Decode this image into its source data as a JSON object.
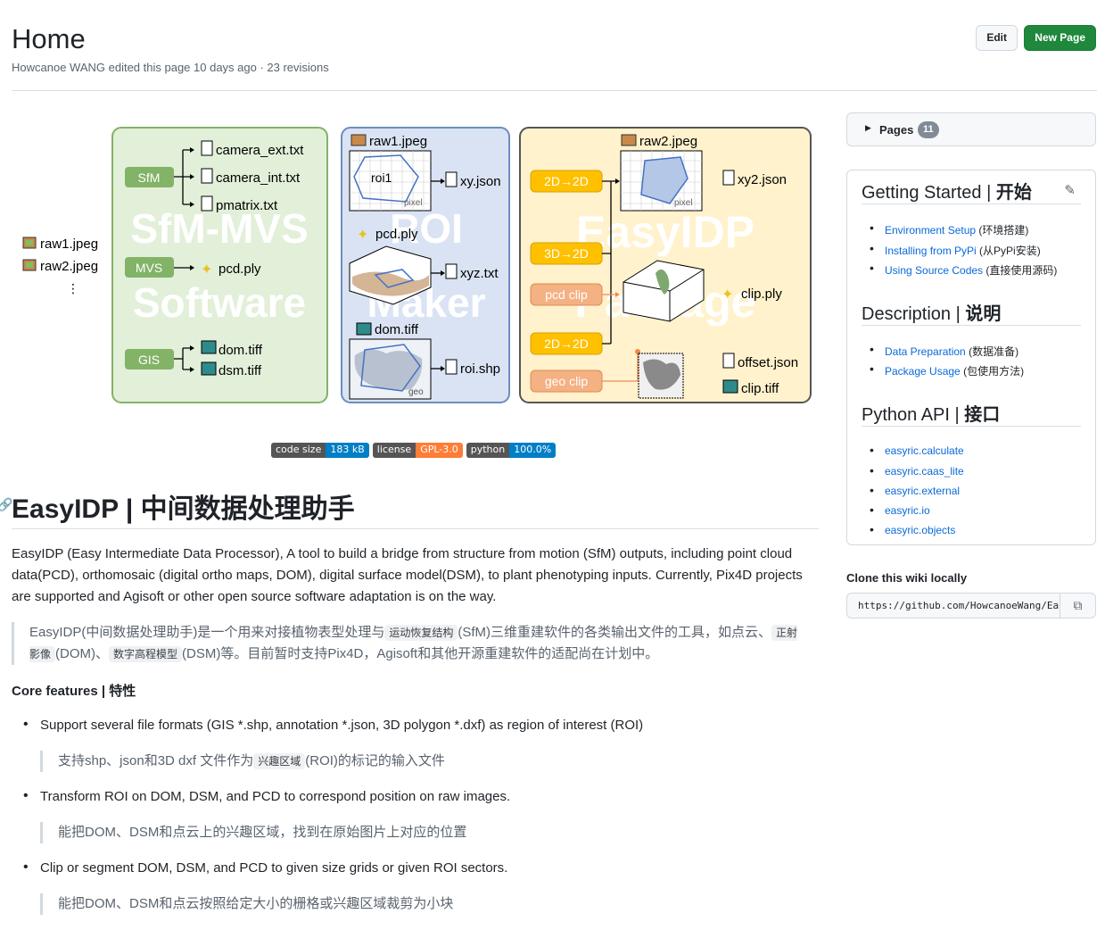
{
  "header": {
    "title": "Home",
    "meta": "Howcanoe WANG edited this page 10 days ago · 23 revisions",
    "edit_label": "Edit",
    "new_page_label": "New Page"
  },
  "figure": {
    "inputs": [
      "raw1.jpeg",
      "raw2.jpeg",
      "⋮"
    ],
    "sfm_panel": {
      "watermark_1": "SfM-MVS",
      "watermark_2": "Software",
      "sfm_label": "SfM",
      "mvs_label": "MVS",
      "gis_label": "GIS",
      "sfm_outputs": [
        "camera_ext.txt",
        "camera_int.txt",
        "pmatrix.txt"
      ],
      "mvs_output": "pcd.ply",
      "gis_outputs": [
        "dom.tiff",
        "dsm.tiff"
      ]
    },
    "roi_panel": {
      "watermark_1": "ROI",
      "watermark_2": "Maker",
      "raw": "raw1.jpeg",
      "roi_label": "roi1",
      "pixel_label": "pixel",
      "geo_label": "geo",
      "pcd": "pcd.ply",
      "dom": "dom.tiff",
      "outputs": [
        "xy.json",
        "xyz.txt",
        "roi.shp"
      ]
    },
    "pkg_panel": {
      "watermark_1": "EasyIDP",
      "watermark_2": "Package",
      "raw": "raw2.jpeg",
      "pixel_label": "pixel",
      "ops": [
        "2D→2D",
        "3D→2D",
        "pcd clip",
        "2D→2D",
        "geo clip"
      ],
      "outputs": [
        "xy2.json",
        "clip.ply",
        "offset.json",
        "clip.tiff"
      ]
    }
  },
  "badges": [
    {
      "key": "code size",
      "value": "183 kB",
      "color": "#007ec6"
    },
    {
      "key": "license",
      "value": "GPL-3.0",
      "color": "#fe7d37"
    },
    {
      "key": "python",
      "value": "100.0%",
      "color": "#007ec6"
    }
  ],
  "content": {
    "h1": "EasyIDP | 中间数据处理助手",
    "intro": "EasyIDP (Easy Intermediate Data Processor), A tool to build a bridge from structure from motion (SfM) outputs, including point cloud data(PCD), orthomosaic (digital ortho maps, DOM), digital surface model(DSM), to plant phenotyping inputs. Currently, Pix4D projects are supported and Agisoft or other open source software adaptation is on the way.",
    "quote_parts": [
      "EasyIDP(中间数据处理助手)是一个用来对接植物表型处理与",
      "运动恢复结构",
      "(SfM)三维重建软件的各类输出文件的工具，如点云、",
      "正射影像",
      "(DOM)、",
      "数字高程模型",
      "(DSM)等。目前暂时支持Pix4D，Agisoft和其他开源重建软件的适配尚在计划中。"
    ],
    "core_title": "Core features | 特性",
    "features": [
      {
        "en": "Support several file formats (GIS *.shp, annotation *.json, 3D polygon *.dxf) as region of interest (ROI)",
        "zh_pre": "支持shp、json和3D dxf 文件作为",
        "zh_code": "兴趣区域",
        "zh_post": "(ROI)的标记的输入文件"
      },
      {
        "en": "Transform ROI on DOM, DSM, and PCD to correspond position on raw images.",
        "zh_pre": "能把DOM、DSM和点云上的兴趣区域，找到在原始图片上对应的位置",
        "zh_code": "",
        "zh_post": ""
      },
      {
        "en": "Clip or segment DOM, DSM, and PCD to given size grids or given ROI sectors.",
        "zh_pre": "能把DOM、DSM和点云按照给定大小的栅格或兴趣区域裁剪为小块",
        "zh_code": "",
        "zh_post": ""
      }
    ]
  },
  "sidebar": {
    "pages_label": "Pages",
    "pages_count": "11",
    "sections": [
      {
        "title_en": "Getting Started | ",
        "title_zh": "开始",
        "items": [
          {
            "link": "Environment Setup",
            "suffix": " (环境搭建)"
          },
          {
            "link": "Installing from PyPi",
            "suffix": " (从PyPi安装)"
          },
          {
            "link": "Using Source Codes",
            "suffix": " (直接使用源码)"
          }
        ]
      },
      {
        "title_en": "Description | ",
        "title_zh": "说明",
        "items": [
          {
            "link": "Data Preparation",
            "suffix": " (数据准备)"
          },
          {
            "link": "Package Usage",
            "suffix": " (包使用方法)"
          }
        ]
      },
      {
        "title_en": "Python API | ",
        "title_zh": "接口",
        "items": [
          {
            "link": "easyric.calculate",
            "suffix": ""
          },
          {
            "link": "easyric.caas_lite",
            "suffix": ""
          },
          {
            "link": "easyric.external",
            "suffix": ""
          },
          {
            "link": "easyric.io",
            "suffix": ""
          },
          {
            "link": "easyric.objects",
            "suffix": ""
          }
        ]
      }
    ],
    "clone_label": "Clone this wiki locally",
    "clone_url": "https://github.com/HowcanoeWang/EasyIDP.wiki.git"
  }
}
